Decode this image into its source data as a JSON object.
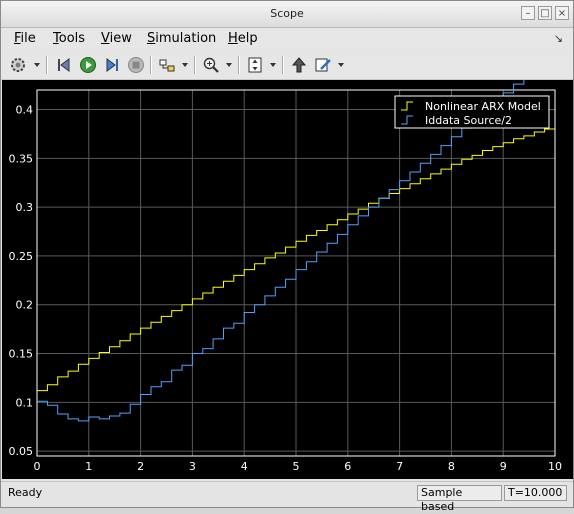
{
  "window": {
    "title": "Scope"
  },
  "menu": [
    {
      "label": "File",
      "mnemonic": "F"
    },
    {
      "label": "Tools",
      "mnemonic": "T"
    },
    {
      "label": "View",
      "mnemonic": "V"
    },
    {
      "label": "Simulation",
      "mnemonic": "S"
    },
    {
      "label": "Help",
      "mnemonic": "H"
    }
  ],
  "toolbar_icons": [
    "gear-icon",
    "step-back-icon",
    "run-icon",
    "step-forward-icon",
    "stop-icon",
    "signal-selector-icon",
    "zoom-in-icon",
    "autoscale-icon",
    "highlight-block-icon",
    "edit-style-icon"
  ],
  "status": {
    "ready": "Ready",
    "sample_mode": "Sample based",
    "time": "T=10.000"
  },
  "colors": {
    "plot_bg": "#000000",
    "axes_color": "#ffffff",
    "series1": "#ffff00",
    "series2": "#4fa3ff"
  },
  "chart_data": {
    "type": "line",
    "xlim": [
      0,
      10
    ],
    "ylim": [
      0.045,
      0.42
    ],
    "xticks": [
      "0",
      "1",
      "2",
      "3",
      "4",
      "5",
      "6",
      "7",
      "8",
      "9",
      "10"
    ],
    "yticks": [
      "0.05",
      "0.1",
      "0.15",
      "0.2",
      "0.25",
      "0.3",
      "0.35",
      "0.4"
    ],
    "grid": true,
    "legend_position": "top-right",
    "step": true,
    "x": [
      0,
      0.2,
      0.4,
      0.6,
      0.8,
      1.0,
      1.2,
      1.4,
      1.6,
      1.8,
      2.0,
      2.2,
      2.4,
      2.6,
      2.8,
      3.0,
      3.2,
      3.4,
      3.6,
      3.8,
      4.0,
      4.2,
      4.4,
      4.6,
      4.8,
      5.0,
      5.2,
      5.4,
      5.6,
      5.8,
      6.0,
      6.2,
      6.4,
      6.6,
      6.8,
      7.0,
      7.2,
      7.4,
      7.6,
      7.8,
      8.0,
      8.2,
      8.4,
      8.6,
      8.8,
      9.0,
      9.2,
      9.4,
      9.6,
      9.8
    ],
    "series": [
      {
        "name": "Nonlinear ARX Model",
        "values": [
          0.112,
          0.118,
          0.126,
          0.132,
          0.139,
          0.145,
          0.151,
          0.157,
          0.163,
          0.17,
          0.176,
          0.182,
          0.188,
          0.194,
          0.2,
          0.206,
          0.212,
          0.218,
          0.224,
          0.23,
          0.236,
          0.242,
          0.248,
          0.253,
          0.259,
          0.265,
          0.271,
          0.276,
          0.282,
          0.287,
          0.293,
          0.298,
          0.304,
          0.309,
          0.314,
          0.319,
          0.324,
          0.329,
          0.334,
          0.339,
          0.344,
          0.349,
          0.353,
          0.358,
          0.362,
          0.366,
          0.37,
          0.373,
          0.377,
          0.38
        ]
      },
      {
        "name": "Iddata Source/2",
        "values": [
          0.101,
          0.097,
          0.088,
          0.083,
          0.081,
          0.085,
          0.083,
          0.086,
          0.089,
          0.098,
          0.108,
          0.116,
          0.121,
          0.133,
          0.138,
          0.15,
          0.155,
          0.165,
          0.176,
          0.181,
          0.192,
          0.2,
          0.209,
          0.218,
          0.226,
          0.236,
          0.244,
          0.254,
          0.263,
          0.272,
          0.282,
          0.291,
          0.3,
          0.309,
          0.318,
          0.327,
          0.336,
          0.345,
          0.354,
          0.363,
          0.372,
          0.381,
          0.39,
          0.399,
          0.408,
          0.417,
          0.426,
          0.435,
          0.444,
          0.453
        ]
      }
    ]
  }
}
